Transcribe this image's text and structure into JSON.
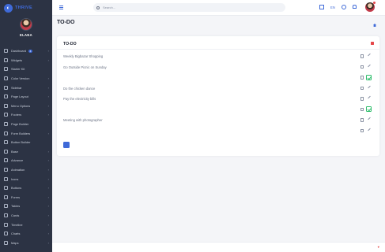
{
  "brand": {
    "name": "THRIVE"
  },
  "profile": {
    "name": "ELANA",
    "role": ""
  },
  "sidebar": {
    "items": [
      {
        "label": "Dashboard",
        "badge": "4",
        "badge_color": "blue",
        "caret": true
      },
      {
        "label": "Widgets",
        "caret": true
      },
      {
        "label": "Starter Kit",
        "caret": false
      },
      {
        "label": "Color Version",
        "caret": true
      },
      {
        "label": "Sidebar",
        "caret": true
      },
      {
        "label": "Page Layout",
        "caret": true
      },
      {
        "label": "Menu Options",
        "caret": true
      },
      {
        "label": "Footers",
        "caret": true
      },
      {
        "label": "Page Builder",
        "caret": false
      },
      {
        "label": "Form Builders",
        "caret": true
      },
      {
        "label": "Button Builder",
        "caret": false
      },
      {
        "label": "Base",
        "caret": true
      },
      {
        "label": "Advance",
        "caret": true
      },
      {
        "label": "Animation",
        "badge": "",
        "badge_color": "red",
        "caret": true
      },
      {
        "label": "Icons",
        "caret": true
      },
      {
        "label": "Buttons",
        "caret": true
      },
      {
        "label": "Forms",
        "caret": true
      },
      {
        "label": "Tables",
        "caret": true
      },
      {
        "label": "Cards",
        "caret": true
      },
      {
        "label": "Timeline",
        "caret": true
      },
      {
        "label": "Charts",
        "caret": true
      },
      {
        "label": "Maps",
        "caret": true
      }
    ]
  },
  "header": {
    "search_placeholder": "Search...",
    "language": "EN"
  },
  "page": {
    "title": "TO-DO",
    "subtitle": "",
    "breadcrumb": ""
  },
  "todo": {
    "card_title": "TO-DO",
    "mark_all_label": "",
    "tasks": [
      {
        "label": "Weekly Bigbazar Shopping",
        "done": false
      },
      {
        "label": "Go Outside Picnic on Sunday",
        "done": false
      },
      {
        "label": "",
        "done": true
      },
      {
        "label": "Do the chicken dance",
        "done": false
      },
      {
        "label": "Pay the electricity bills",
        "done": false
      },
      {
        "label": "",
        "done": true
      },
      {
        "label": "Meeting with photographer",
        "done": false
      },
      {
        "label": "",
        "done": false
      }
    ],
    "add_button_label": ""
  },
  "footer": {
    "copyright": "",
    "credit": ""
  },
  "colors": {
    "accent": "#3f6ad8",
    "sidebar_bg": "#2c3344",
    "danger": "#e5474a",
    "success": "#2ebd6b"
  },
  "icons": {
    "menu": "hamburger-icon",
    "search": "search-icon",
    "fullscreen": "fullscreen-icon",
    "settings": "settings-icon",
    "notifications": "bell-icon",
    "trash": "trash-icon",
    "edit": "pencil-icon",
    "check": "check-icon",
    "home": "home-icon",
    "heart": "heart-icon"
  }
}
